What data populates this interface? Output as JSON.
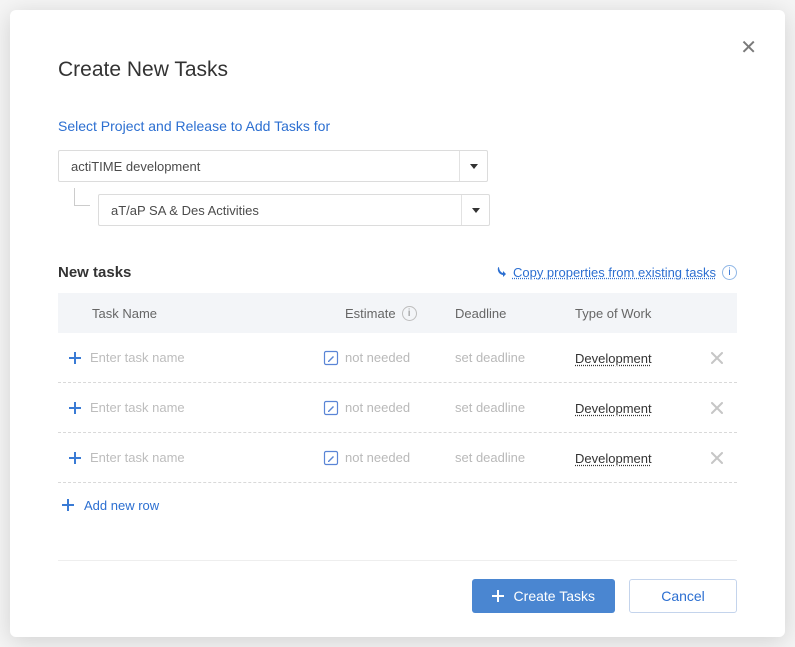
{
  "modal": {
    "title": "Create New Tasks",
    "subtitle": "Select Project and Release to Add Tasks for",
    "project": "actiTIME development",
    "release": "aT/aP SA & Des Activities"
  },
  "tasks_section": {
    "heading": "New tasks",
    "copy_link_label": "Copy properties from existing tasks"
  },
  "columns": {
    "name": "Task Name",
    "estimate": "Estimate",
    "deadline": "Deadline",
    "type_of_work": "Type of Work"
  },
  "row_defaults": {
    "name_placeholder": "Enter task name",
    "estimate_text": "not needed",
    "deadline_text": "set deadline",
    "type_of_work": "Development"
  },
  "rows": [
    {
      "name": ""
    },
    {
      "name": ""
    },
    {
      "name": ""
    }
  ],
  "add_row_label": "Add new row",
  "footer": {
    "primary": "Create Tasks",
    "secondary": "Cancel"
  }
}
